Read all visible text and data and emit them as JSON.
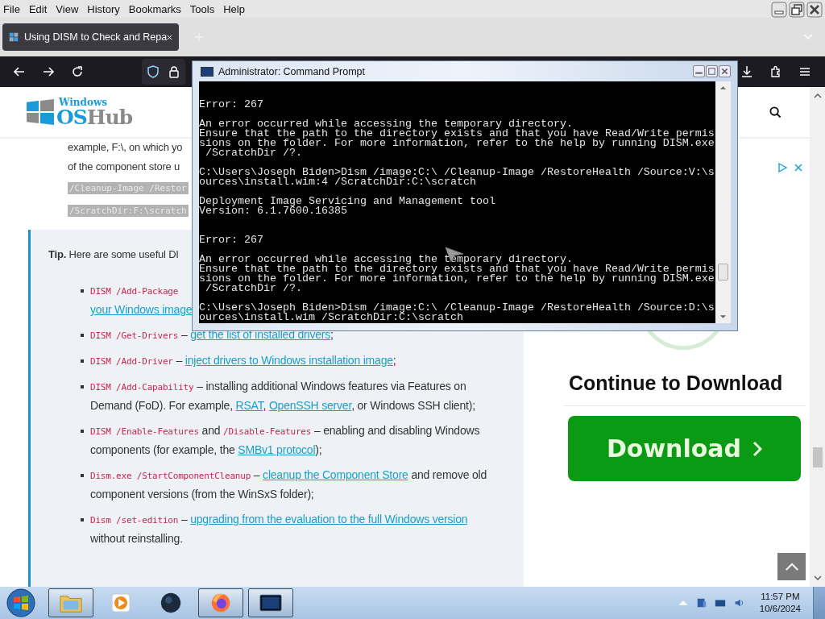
{
  "menu_bar": [
    "File",
    "Edit",
    "View",
    "History",
    "Bookmarks",
    "Tools",
    "Help"
  ],
  "tab": {
    "title": "Using DISM to Check and Repa"
  },
  "header": {
    "logo": {
      "small": "Windows",
      "name_parts": [
        "OS",
        "Hub"
      ]
    }
  },
  "article": {
    "paragraph_lines": [
      "example, F:\\, on which yo",
      "of the component store u"
    ],
    "code_lines": [
      "/Cleanup-Image /Restor",
      "/ScratchDir:F:\\scratch"
    ],
    "tip": {
      "lead": "**Tip.** Here are some useful DI",
      "items": [
        {
          "segments": [
            {
              "kind": "code",
              "text": "DISM /Add-Package"
            },
            {
              "kind": "link",
              "text": "your Windows image",
              "newline": true
            }
          ]
        },
        {
          "segments": [
            {
              "kind": "code",
              "text": "DISM /Get-Drivers"
            },
            {
              "kind": "text",
              "text": " – "
            },
            {
              "kind": "link",
              "text": "get the list of installed drivers"
            },
            {
              "kind": "text",
              "text": ";"
            }
          ]
        },
        {
          "segments": [
            {
              "kind": "code",
              "text": "DISM /Add-Driver"
            },
            {
              "kind": "text",
              "text": " – "
            },
            {
              "kind": "link",
              "text": "inject drivers to Windows installation image"
            },
            {
              "kind": "text",
              "text": ";"
            }
          ]
        },
        {
          "segments": [
            {
              "kind": "code",
              "text": "DISM /Add-Capability"
            },
            {
              "kind": "text",
              "text": " – installing additional Windows features via Features on Demand (FoD). For example, "
            },
            {
              "kind": "link",
              "text": "RSAT"
            },
            {
              "kind": "text",
              "text": ", "
            },
            {
              "kind": "link",
              "text": "OpenSSH server"
            },
            {
              "kind": "text",
              "text": ", or Windows SSH client);"
            }
          ]
        },
        {
          "segments": [
            {
              "kind": "code",
              "text": "DISM /Enable-Features"
            },
            {
              "kind": "text",
              "text": " and "
            },
            {
              "kind": "code",
              "text": "/Disable-Features"
            },
            {
              "kind": "text",
              "text": " – enabling and disabling Windows components (for example, the "
            },
            {
              "kind": "link",
              "text": "SMBv1 protocol"
            },
            {
              "kind": "text",
              "text": ");"
            }
          ]
        },
        {
          "segments": [
            {
              "kind": "code",
              "text": "Dism.exe /StartComponentCleanup"
            },
            {
              "kind": "text",
              "text": " – "
            },
            {
              "kind": "link",
              "text": "cleanup the Component Store"
            },
            {
              "kind": "text",
              "text": " and remove old component versions (from the WinSxS folder);"
            }
          ]
        },
        {
          "segments": [
            {
              "kind": "code",
              "text": "Dism /set-edition"
            },
            {
              "kind": "text",
              "text": " – "
            },
            {
              "kind": "link",
              "text": "upgrading from the evaluation to the full Windows version"
            },
            {
              "kind": "text",
              "text": " without reinstalling."
            }
          ]
        }
      ]
    }
  },
  "sidebar": {
    "heading": "Continue to Download",
    "button": "Download"
  },
  "console_window": {
    "title": "Administrator: Command Prompt",
    "blocks": [
      {
        "lines": [
          "Error: 267"
        ]
      },
      {
        "lines": [
          "An error occurred while accessing the temporary directory.",
          "Ensure that the path to the directory exists and that you have Read/Write permis",
          "sions on the folder. For more information, refer to the help by running DISM.exe",
          " /ScratchDir /?."
        ]
      },
      {
        "lines": [
          "C:\\Users\\Joseph Biden>Dism /image:C:\\ /Cleanup-Image /RestoreHealth /Source:V:\\s",
          "ources\\install.wim:4 /ScratchDir:C:\\scratch"
        ]
      },
      {
        "lines": [
          "Deployment Image Servicing and Management tool",
          "Version: 6.1.7600.16385"
        ]
      },
      {
        "lines": [
          "Error: 267"
        ],
        "wide_gap": true
      },
      {
        "lines": [
          "An error occurred while accessing the temporary directory.",
          "Ensure that the path to the directory exists and that you have Read/Write permis",
          "sions on the folder. For more information, refer to the help by running DISM.exe",
          " /ScratchDir /?."
        ]
      },
      {
        "lines": [
          "C:\\Users\\Joseph Biden>Dism /image:C:\\ /Cleanup-Image /RestoreHealth /Source:D:\\s",
          "ources\\install.wim /ScratchDir:C:\\scratch"
        ]
      }
    ]
  },
  "taskbar": {
    "apps": [
      {
        "kind": "folder",
        "open": true
      },
      {
        "kind": "media",
        "open": false
      },
      {
        "kind": "globe",
        "open": false
      },
      {
        "kind": "browser",
        "open": true
      },
      {
        "kind": "console",
        "open": true
      }
    ],
    "clock": {
      "time": "11:57 PM",
      "date": "10/6/2024"
    }
  }
}
